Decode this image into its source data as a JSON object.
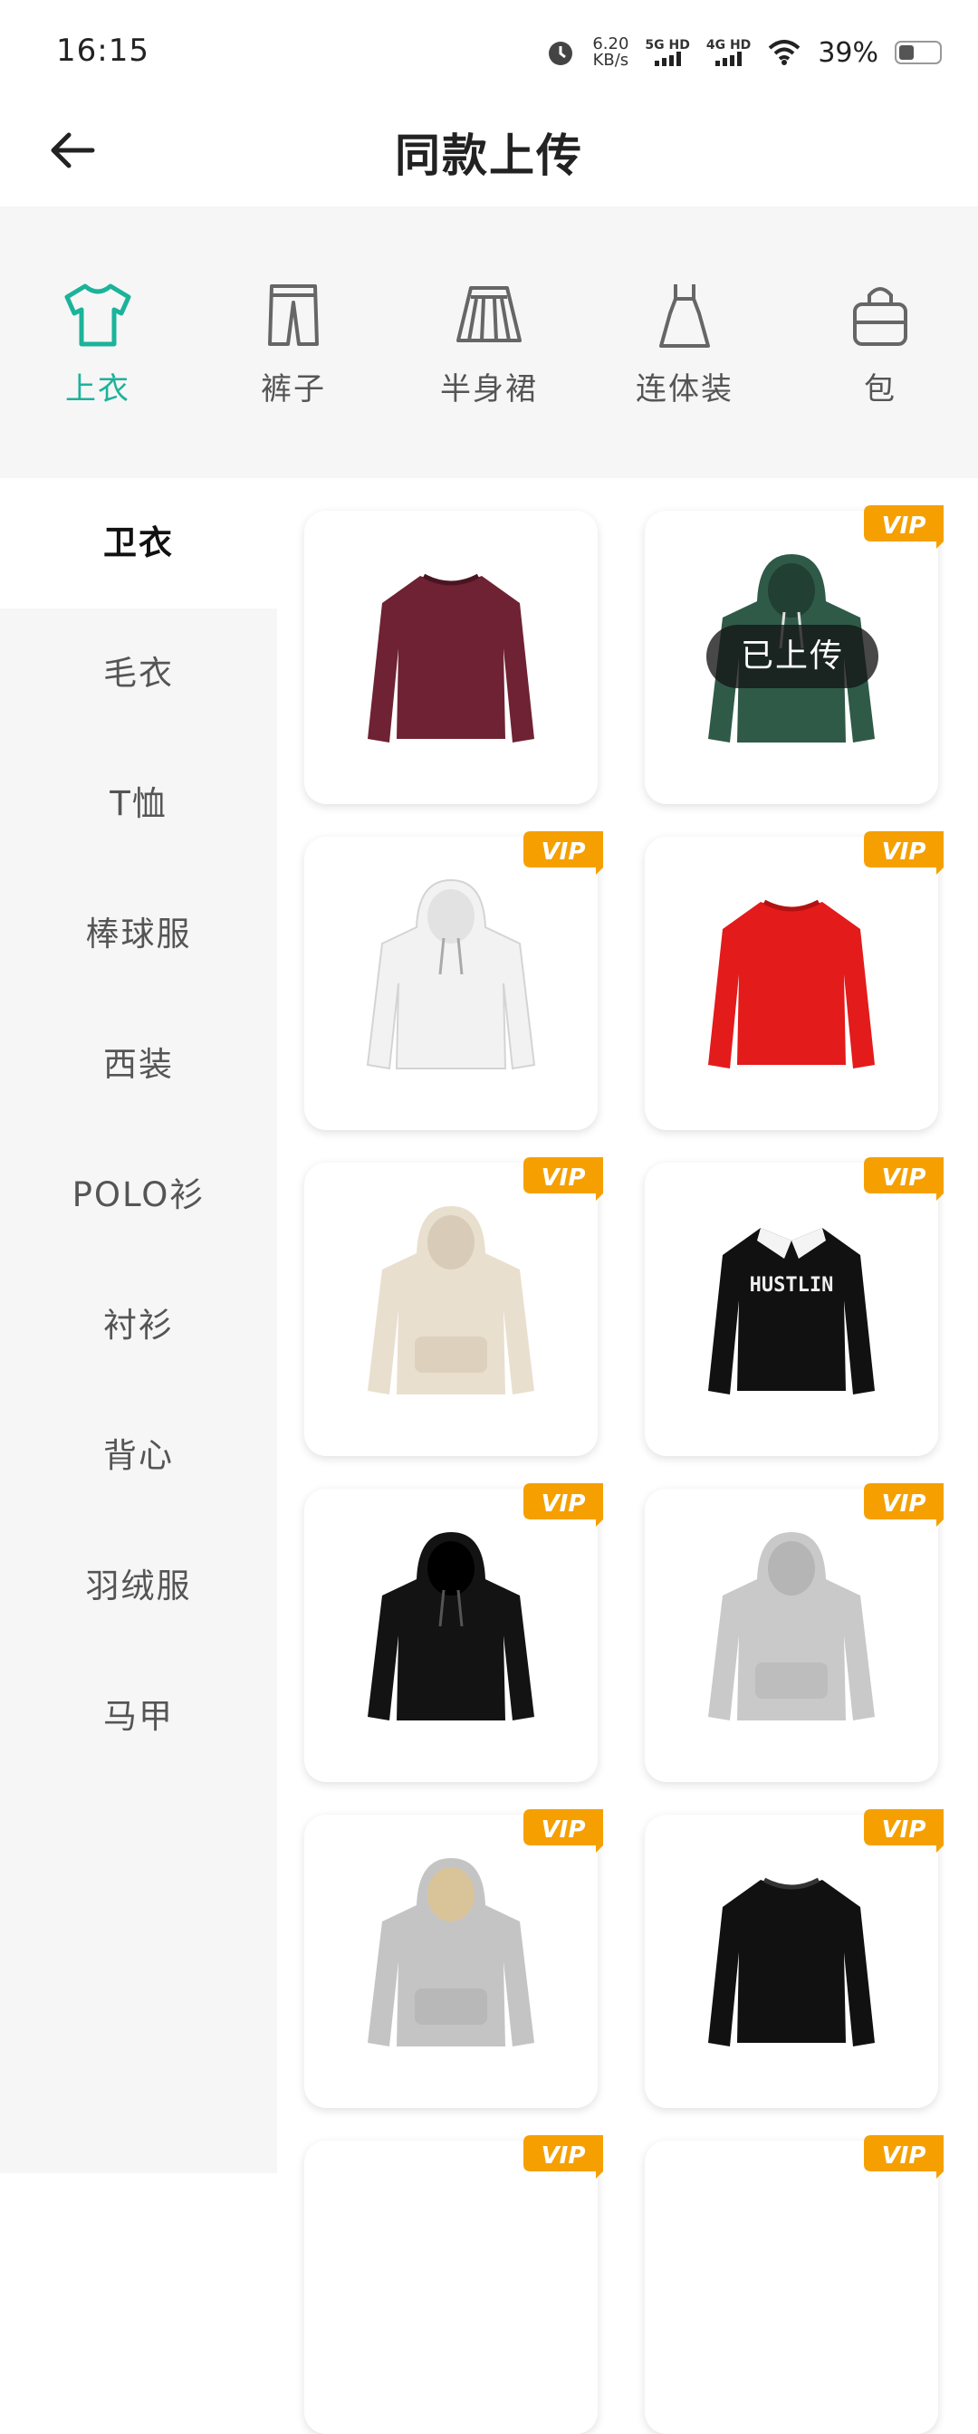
{
  "status_bar": {
    "time": "16:15",
    "net_speed_value": "6.20",
    "net_speed_unit": "KB/s",
    "sim1": "5G HD",
    "sim2": "4G HD",
    "battery": "39%",
    "icons": [
      "alarm-icon",
      "signal-icon",
      "wifi-icon",
      "battery-icon"
    ]
  },
  "header": {
    "title": "同款上传",
    "back_icon": "arrow-left-icon"
  },
  "categories": [
    {
      "label": "上衣",
      "icon": "tshirt-icon",
      "active": true
    },
    {
      "label": "裤子",
      "icon": "pants-icon"
    },
    {
      "label": "半身裙",
      "icon": "skirt-icon"
    },
    {
      "label": "连体装",
      "icon": "dress-icon"
    },
    {
      "label": "包",
      "icon": "bag-icon"
    }
  ],
  "subcategories": [
    {
      "label": "卫衣",
      "active": true
    },
    {
      "label": "毛衣"
    },
    {
      "label": "T恤"
    },
    {
      "label": "棒球服"
    },
    {
      "label": "西装"
    },
    {
      "label": "POLO衫"
    },
    {
      "label": "衬衫"
    },
    {
      "label": "背心"
    },
    {
      "label": "羽绒服"
    },
    {
      "label": "马甲"
    }
  ],
  "products": [
    {
      "color": "#6e2233",
      "type": "crewneck",
      "vip": false
    },
    {
      "color": "#2f5a48",
      "type": "hoodie",
      "vip": true,
      "overlay": "已上传"
    },
    {
      "color": "#f2f2f2",
      "type": "hoodie",
      "vip": true
    },
    {
      "color": "#e31b1b",
      "type": "crewneck",
      "vip": true
    },
    {
      "color": "#e9dfce",
      "type": "hoodie",
      "vip": true
    },
    {
      "color": "#111111",
      "type": "polo",
      "vip": true,
      "print": "HUSTLIN"
    },
    {
      "color": "#131313",
      "type": "hoodie",
      "vip": true
    },
    {
      "color": "#c9c9c9",
      "type": "hoodie",
      "vip": true
    },
    {
      "color": "#c4c4c4",
      "type": "hoodie",
      "vip": true
    },
    {
      "color": "#111111",
      "type": "crewneck",
      "vip": true
    }
  ],
  "vip_badge": "VIP",
  "colors": {
    "accent": "#1bb39a",
    "vip": "#f5a000"
  }
}
